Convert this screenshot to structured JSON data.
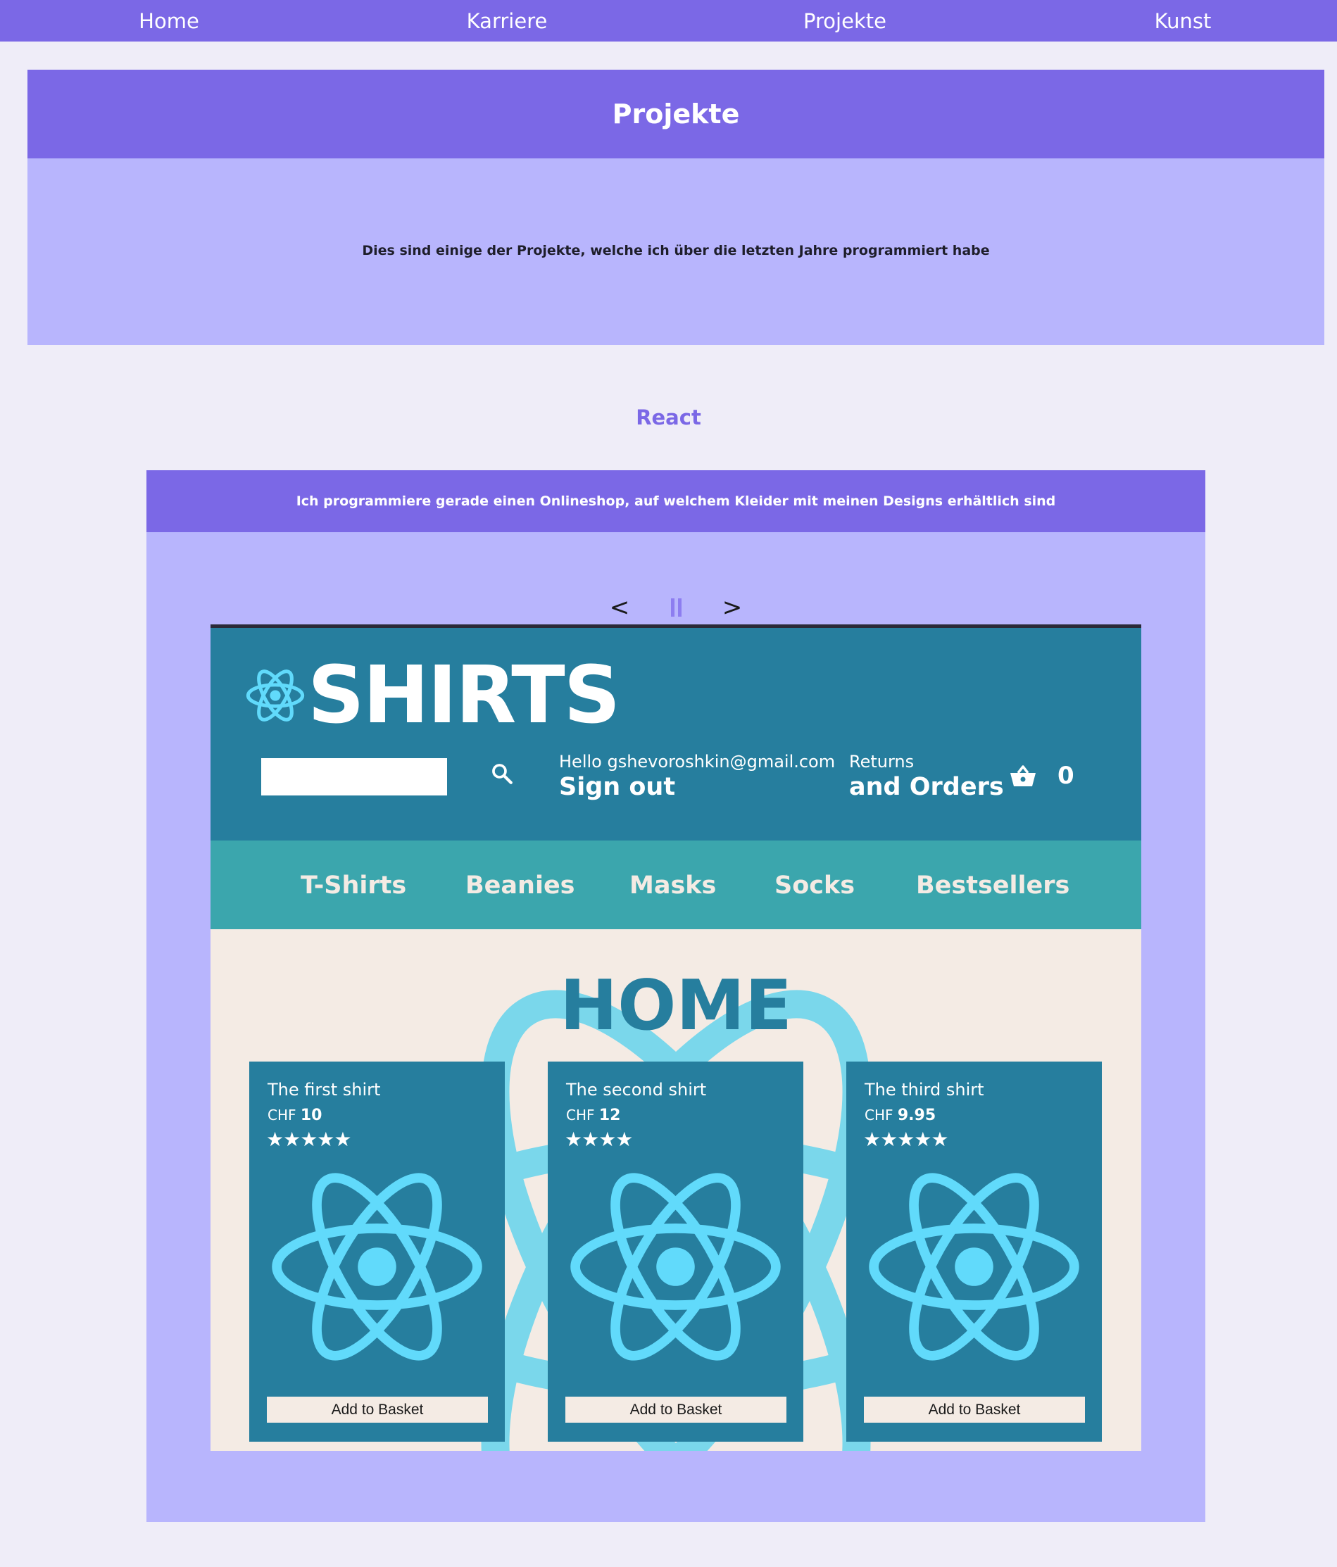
{
  "nav": {
    "items": [
      {
        "label": "Home"
      },
      {
        "label": "Karriere"
      },
      {
        "label": "Projekte"
      },
      {
        "label": "Kunst"
      }
    ]
  },
  "hero": {
    "title": "Projekte",
    "text": "Dies sind einige der Projekte, welche ich über die letzten Jahre programmiert habe"
  },
  "section": {
    "title": "React"
  },
  "project": {
    "description": "Ich programmiere gerade einen Onlineshop, auf welchem Kleider mit meinen Designs erhältlich sind",
    "controls": {
      "prev": "<",
      "next": ">"
    },
    "screenshot": {
      "logo_text": "SHIRTS",
      "greeting_line1": "Hello gshevoroshkin@gmail.com",
      "greeting_line2": "Sign out",
      "returns_line1": "Returns",
      "returns_line2": "and Orders",
      "basket_count": "0",
      "categories": [
        "T-Shirts",
        "Beanies",
        "Masks",
        "Socks",
        "Bestsellers"
      ],
      "home_title": "HOME",
      "products": [
        {
          "name": "The first shirt",
          "currency": "CHF",
          "price": "10",
          "stars": "★★★★★",
          "rating": 5,
          "button": "Add to Basket"
        },
        {
          "name": "The second shirt",
          "currency": "CHF",
          "price": "12",
          "stars": "★★★★",
          "rating": 4,
          "button": "Add to Basket"
        },
        {
          "name": "The third shirt",
          "currency": "CHF",
          "price": "9.95",
          "stars": "★★★★★",
          "rating": 5,
          "button": "Add to Basket"
        }
      ]
    }
  },
  "colors": {
    "accent": "#7b68e6",
    "panel": "#b8b5fd",
    "page_bg": "#efedf8",
    "shop_primary": "#267e9e",
    "shop_secondary": "#3ba6ad",
    "react_blue": "#61dafb",
    "shop_bg": "#f4ebe4"
  }
}
